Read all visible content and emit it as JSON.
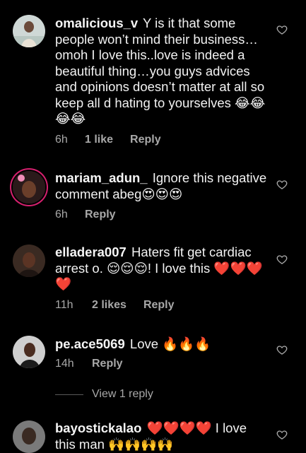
{
  "comments": [
    {
      "username": "omalicious_v",
      "text": "Y is it that some people won’t mind their business… omoh I love this..love is indeed a beautiful thing…you guys advices and opinions doesn’t matter at all so keep all d hating to yourselves 😂😂😂😂",
      "time": "6h",
      "likes": "1 like",
      "reply": "Reply"
    },
    {
      "username": "mariam_adun_",
      "text": "Ignore this negative comment abeg😍😍😍",
      "time": "6h",
      "likes": "",
      "reply": "Reply"
    },
    {
      "username": "elladera007",
      "text": "Haters fit get cardiac arrest o. 😌😌😌! I love this ❤️❤️❤️❤️",
      "time": "11h",
      "likes": "2 likes",
      "reply": "Reply"
    },
    {
      "username": "pe.ace5069",
      "text": "Love 🔥🔥🔥",
      "time": "14h",
      "likes": "",
      "reply": "Reply"
    },
    {
      "username": "bayostickalao",
      "text": "❤️❤️❤️❤️ I love this man 🙌🙌🙌🙌",
      "time": "",
      "likes": "",
      "reply": ""
    }
  ],
  "view_replies": "View 1 reply",
  "icons": {
    "like": "heart-outline-icon"
  }
}
